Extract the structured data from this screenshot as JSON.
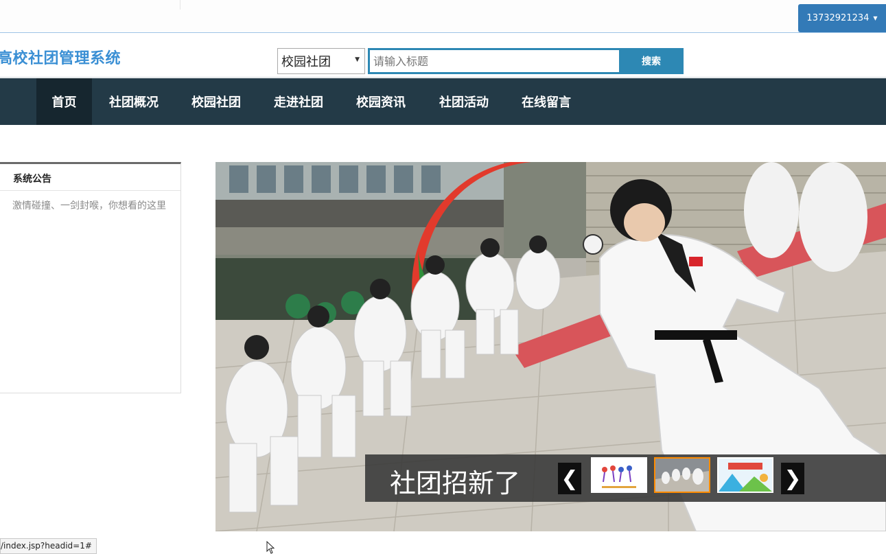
{
  "user": {
    "label": "13732921234"
  },
  "header": {
    "brand": "高校社团管理系统",
    "search": {
      "category": "校园社团",
      "placeholder": "请输入标题",
      "button": "搜索"
    }
  },
  "nav": {
    "items": [
      {
        "label": "首页",
        "active": true
      },
      {
        "label": "社团概况"
      },
      {
        "label": "校园社团"
      },
      {
        "label": "走进社团"
      },
      {
        "label": "校园资讯"
      },
      {
        "label": "社团活动"
      },
      {
        "label": "在线留言"
      }
    ]
  },
  "notice": {
    "title": "系统公告",
    "text": "激情碰撞、一剑封喉，你想看的这里"
  },
  "slider": {
    "caption": "社团招新了",
    "prev": "❮",
    "next": "❯",
    "active_thumb_index": 1
  },
  "status": {
    "url": "/index.jsp?headid=1#"
  },
  "colors": {
    "nav_bg": "#233a47",
    "nav_active": "#16262f",
    "brand": "#3a8fd4",
    "search_accent": "#2d88b4",
    "user_button": "#337ab7",
    "thumb_active": "#ff8c00"
  }
}
